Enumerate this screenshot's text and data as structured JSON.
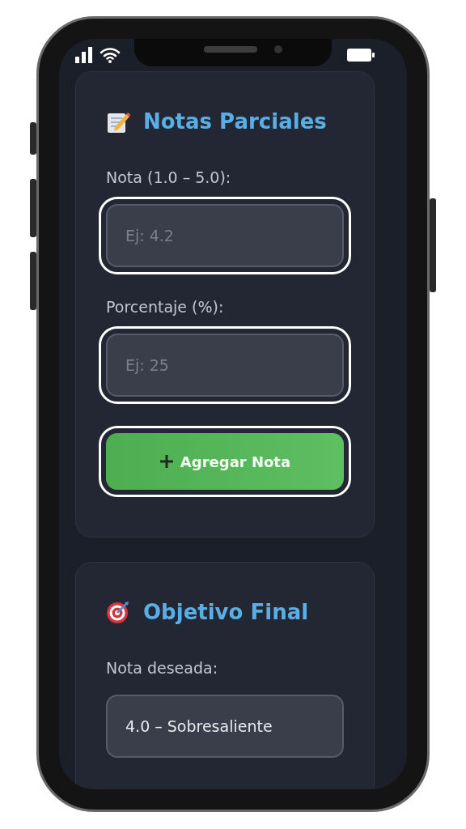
{
  "cards": [
    {
      "kind": "memo",
      "title": "Notas Parciales",
      "fields": [
        {
          "kind": "input",
          "label": "Nota (1.0 – 5.0):",
          "placeholder": "Ej: 4.2",
          "highlighted": true
        },
        {
          "kind": "input",
          "label": "Porcentaje (%):",
          "placeholder": "Ej: 25",
          "highlighted": true
        }
      ],
      "button": {
        "label": "Agregar Nota",
        "highlighted": true
      }
    },
    {
      "kind": "target",
      "title": "Objetivo Final",
      "fields": [
        {
          "kind": "select",
          "label": "Nota deseada:",
          "value": "4.0 – Sobresaliente",
          "highlighted": false
        }
      ]
    }
  ]
}
